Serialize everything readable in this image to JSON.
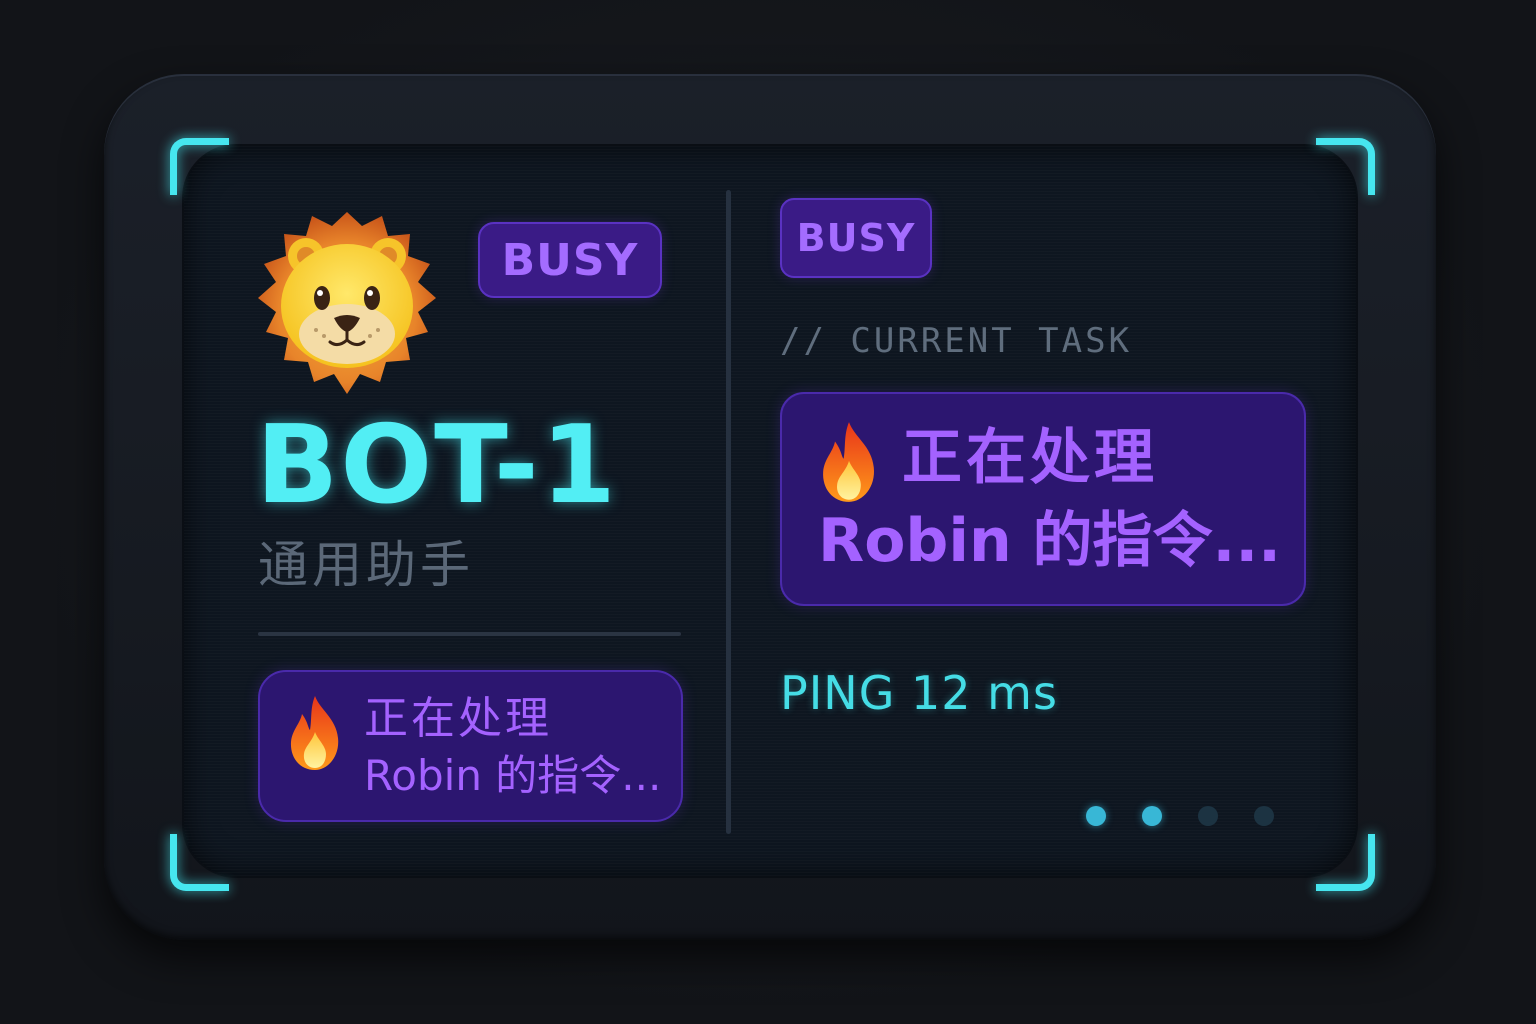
{
  "device": {
    "accent_color": "#46e6ef",
    "status_color": "#a46cff",
    "screen_color": "#0e1620"
  },
  "left_panel": {
    "avatar": {
      "icon": "lion-face-icon"
    },
    "status_badge": "BUSY",
    "bot_name": "BOT-1",
    "bot_role": "通用助手",
    "task": {
      "icon": "fire-icon",
      "line1": "正在处理",
      "line2": "Robin 的指令..."
    }
  },
  "right_panel": {
    "status_badge": "BUSY",
    "section_label": "// CURRENT TASK",
    "task": {
      "icon": "fire-icon",
      "line1": "正在处理",
      "line2": "Robin 的指令..."
    },
    "ping_text": "PING 12 ms"
  },
  "pagination": {
    "total_pages": 4,
    "active_pages": [
      1,
      2
    ]
  }
}
